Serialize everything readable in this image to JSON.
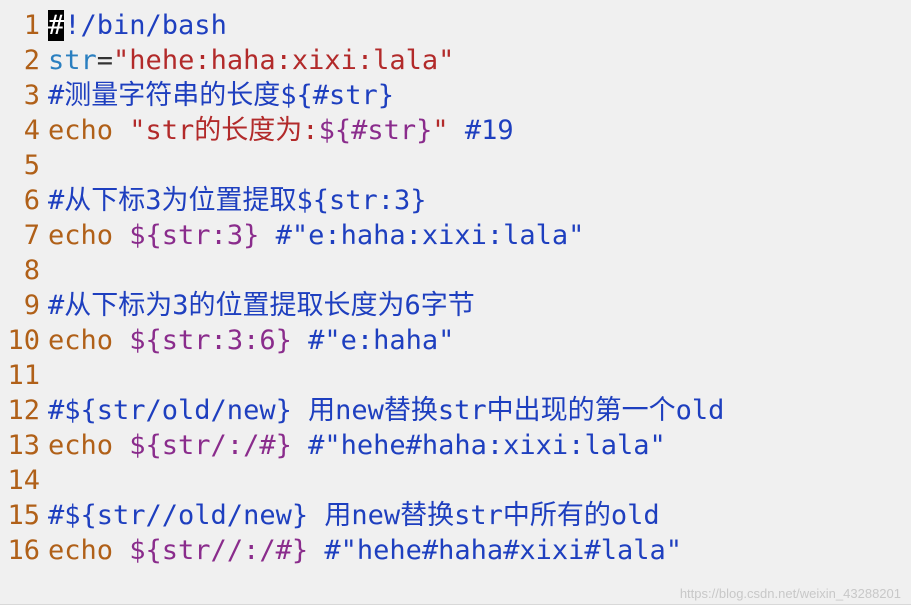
{
  "lines": [
    {
      "n": "1",
      "segs": [
        {
          "t": "#",
          "c": "cursor"
        },
        {
          "t": "!/bin/bash",
          "c": "c-blue"
        }
      ]
    },
    {
      "n": "2",
      "segs": [
        {
          "t": "str",
          "c": "c-var"
        },
        {
          "t": "=",
          "c": "c-op"
        },
        {
          "t": "\"hehe:haha:xixi:lala\"",
          "c": "c-str"
        }
      ]
    },
    {
      "n": "3",
      "segs": [
        {
          "t": "#测量字符串的长度${#str}",
          "c": "c-blue"
        }
      ]
    },
    {
      "n": "4",
      "segs": [
        {
          "t": "echo ",
          "c": "c-brown"
        },
        {
          "t": "\"str的长度为:",
          "c": "c-str"
        },
        {
          "t": "${#str}",
          "c": "c-purple"
        },
        {
          "t": "\" ",
          "c": "c-str"
        },
        {
          "t": "#19",
          "c": "c-blue"
        }
      ]
    },
    {
      "n": "5",
      "segs": []
    },
    {
      "n": "6",
      "segs": [
        {
          "t": "#从下标3为位置提取${str:3}",
          "c": "c-blue"
        }
      ]
    },
    {
      "n": "7",
      "segs": [
        {
          "t": "echo ",
          "c": "c-brown"
        },
        {
          "t": "${str:3}",
          "c": "c-purple"
        },
        {
          "t": " #\"e:haha:xixi:lala\"",
          "c": "c-blue"
        }
      ]
    },
    {
      "n": "8",
      "segs": []
    },
    {
      "n": "9",
      "segs": [
        {
          "t": "#从下标为3的位置提取长度为6字节",
          "c": "c-blue"
        }
      ]
    },
    {
      "n": "10",
      "segs": [
        {
          "t": "echo ",
          "c": "c-brown"
        },
        {
          "t": "${str:3:6}",
          "c": "c-purple"
        },
        {
          "t": " #\"e:haha\"",
          "c": "c-blue"
        }
      ]
    },
    {
      "n": "11",
      "segs": []
    },
    {
      "n": "12",
      "segs": [
        {
          "t": "#${str/old/new} 用new替换str中出现的第一个old",
          "c": "c-blue"
        }
      ]
    },
    {
      "n": "13",
      "segs": [
        {
          "t": "echo ",
          "c": "c-brown"
        },
        {
          "t": "${str/:/#}",
          "c": "c-purple"
        },
        {
          "t": " #\"hehe#haha:xixi:lala\"",
          "c": "c-blue"
        }
      ]
    },
    {
      "n": "14",
      "segs": []
    },
    {
      "n": "15",
      "segs": [
        {
          "t": "#${str//old/new} 用new替换str中所有的old",
          "c": "c-blue"
        }
      ]
    },
    {
      "n": "16",
      "segs": [
        {
          "t": "echo ",
          "c": "c-brown"
        },
        {
          "t": "${str//:/#}",
          "c": "c-purple"
        },
        {
          "t": " #\"hehe#haha#xixi#lala\"",
          "c": "c-blue"
        }
      ]
    }
  ],
  "watermark": "https://blog.csdn.net/weixin_43288201"
}
